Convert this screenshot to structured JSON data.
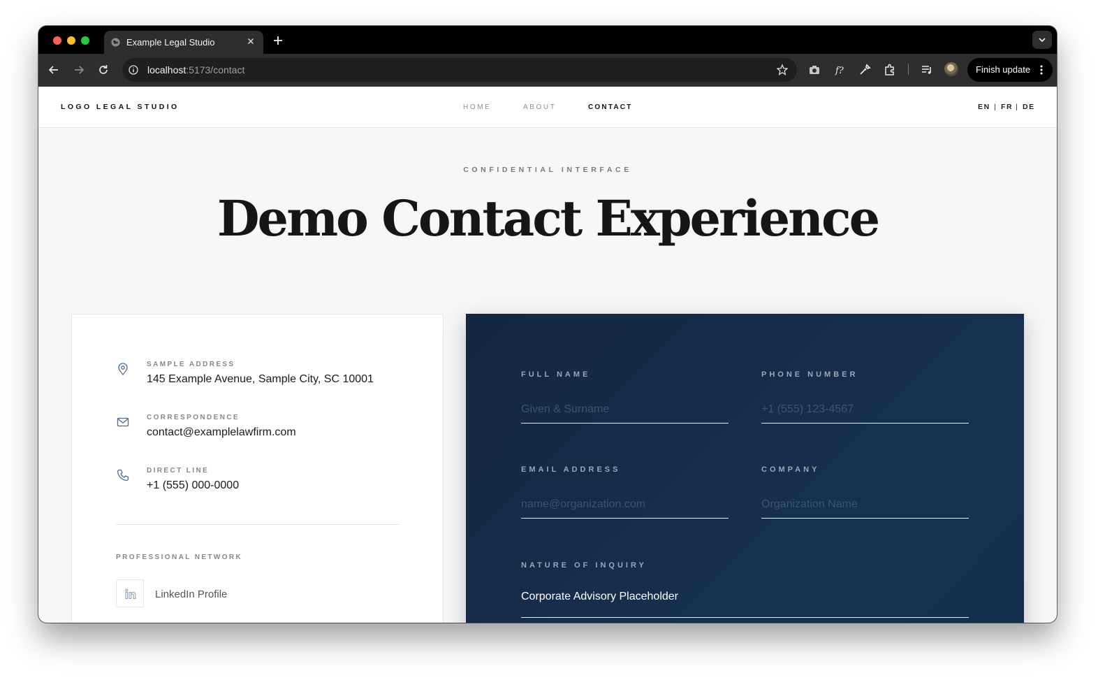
{
  "browser": {
    "tab_title": "Example Legal Studio",
    "url_host": "localhost",
    "url_path": ":5173/contact",
    "finish_update_label": "Finish update"
  },
  "site": {
    "logo": "LOGO LEGAL STUDIO",
    "nav": {
      "home": "HOME",
      "about": "ABOUT",
      "contact": "CONTACT"
    },
    "languages": [
      "EN",
      "FR",
      "DE"
    ],
    "lang_separator": "|"
  },
  "hero": {
    "eyebrow": "CONFIDENTIAL INTERFACE",
    "title": "Demo Contact Experience"
  },
  "info": {
    "address_label": "SAMPLE ADDRESS",
    "address_value": "145 Example Avenue, Sample City, SC 10001",
    "email_label": "CORRESPONDENCE",
    "email_value": "contact@examplelawfirm.com",
    "phone_label": "DIRECT LINE",
    "phone_value": "+1 (555) 000-0000",
    "network_label": "PROFESSIONAL NETWORK",
    "linkedin_label": "LinkedIn Profile"
  },
  "form": {
    "full_name_label": "FULL NAME",
    "full_name_placeholder": "Given & Surname",
    "phone_label": "PHONE NUMBER",
    "phone_placeholder": "+1 (555) 123-4567",
    "email_label": "EMAIL ADDRESS",
    "email_placeholder": "name@organization.com",
    "company_label": "COMPANY",
    "company_placeholder": "Organization Name",
    "inquiry_label": "NATURE OF INQUIRY",
    "inquiry_value": "Corporate Advisory Placeholder"
  },
  "colors": {
    "form_background": "#15304f",
    "page_background": "#f7f7f7",
    "accent_dark": "#161616"
  }
}
